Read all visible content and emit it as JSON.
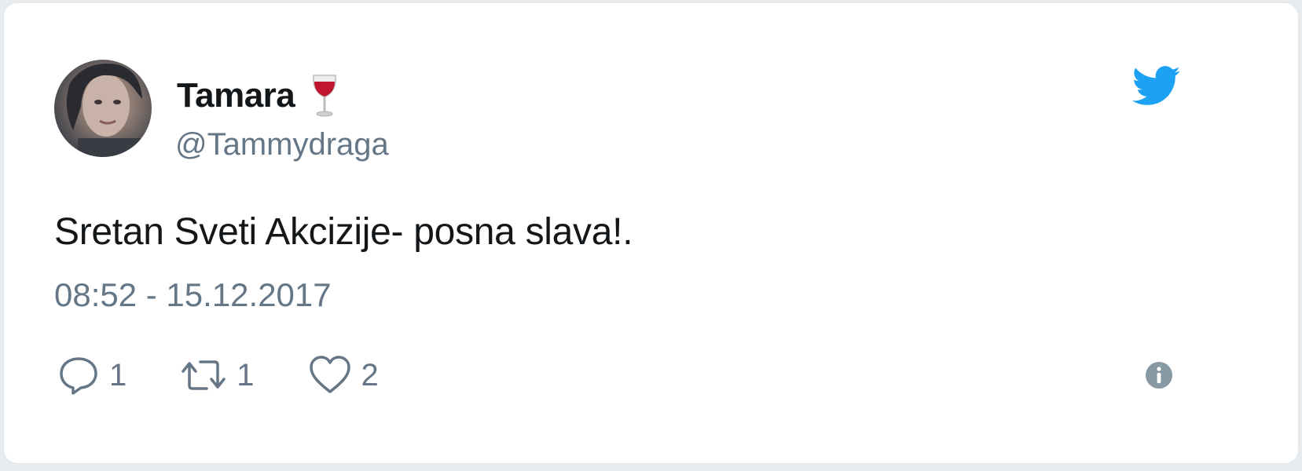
{
  "user": {
    "display_name": "Tamara",
    "handle": "@Tammydraga",
    "name_emoji": "wine-glass-icon"
  },
  "tweet": {
    "text": "Sretan Sveti Akcizije- posna slava!.",
    "timestamp": "08:52 - 15.12.2017"
  },
  "actions": {
    "reply_count": "1",
    "retweet_count": "1",
    "like_count": "2"
  },
  "icons": {
    "brand": "twitter-bird-icon",
    "info": "info-icon"
  },
  "colors": {
    "twitter_blue": "#1da1f2",
    "text_primary": "#14171a",
    "text_secondary": "#657786",
    "wine_red": "#c0152f"
  }
}
